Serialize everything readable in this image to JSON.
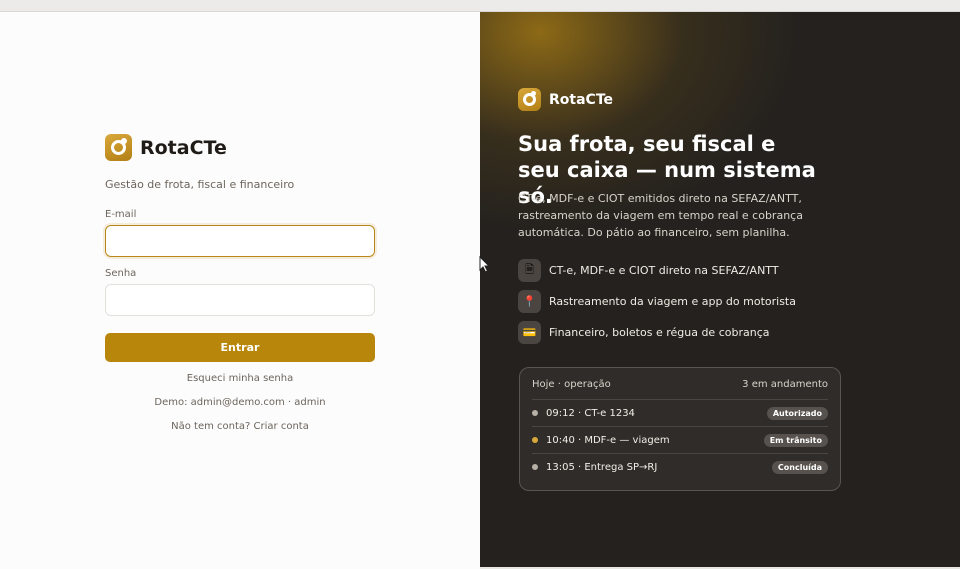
{
  "app": {
    "name": "RotaCTe",
    "tagline": "Gestão de frota, fiscal e financeiro"
  },
  "login": {
    "email_label": "E-mail",
    "email_value": "",
    "password_label": "Senha",
    "password_value": "",
    "submit_label": "Entrar",
    "forgot_label": "Esqueci minha senha",
    "demo_text": "Demo: admin@demo.com · admin",
    "signup_text": "Não tem conta? Criar conta"
  },
  "hero": {
    "brand": "RotaCTe",
    "headline": "Sua frota, seu fiscal e seu caixa — num sistema só.",
    "description": "CT-e, MDF-e e CIOT emitidos direto na SEFAZ/ANTT, rastreamento da viagem em tempo real e cobrança automática. Do pátio ao financeiro, sem planilha.",
    "features": [
      {
        "icon": "document-icon",
        "glyph": "🗎",
        "label": "CT-e, MDF-e e CIOT direto na SEFAZ/ANTT"
      },
      {
        "icon": "pin-icon",
        "glyph": "📍",
        "label": "Rastreamento da viagem e app do motorista"
      },
      {
        "icon": "card-icon",
        "glyph": "💳",
        "label": "Financeiro, boletos e régua de cobrança"
      }
    ]
  },
  "ops_card": {
    "title": "Hoje · operação",
    "summary": "3 em andamento",
    "rows": [
      {
        "text": "09:12 · CT-e 1234",
        "status": "Autorizado",
        "dot_color": "#b7b0a6"
      },
      {
        "text": "10:40 · MDF-e — viagem",
        "status": "Em trânsito",
        "dot_color": "#d9a83a"
      },
      {
        "text": "13:05 · Entrega SP→RJ",
        "status": "Concluída",
        "dot_color": "#b7b0a6"
      }
    ]
  },
  "colors": {
    "accent": "#b8860b",
    "dark_panel": "#24211e"
  }
}
